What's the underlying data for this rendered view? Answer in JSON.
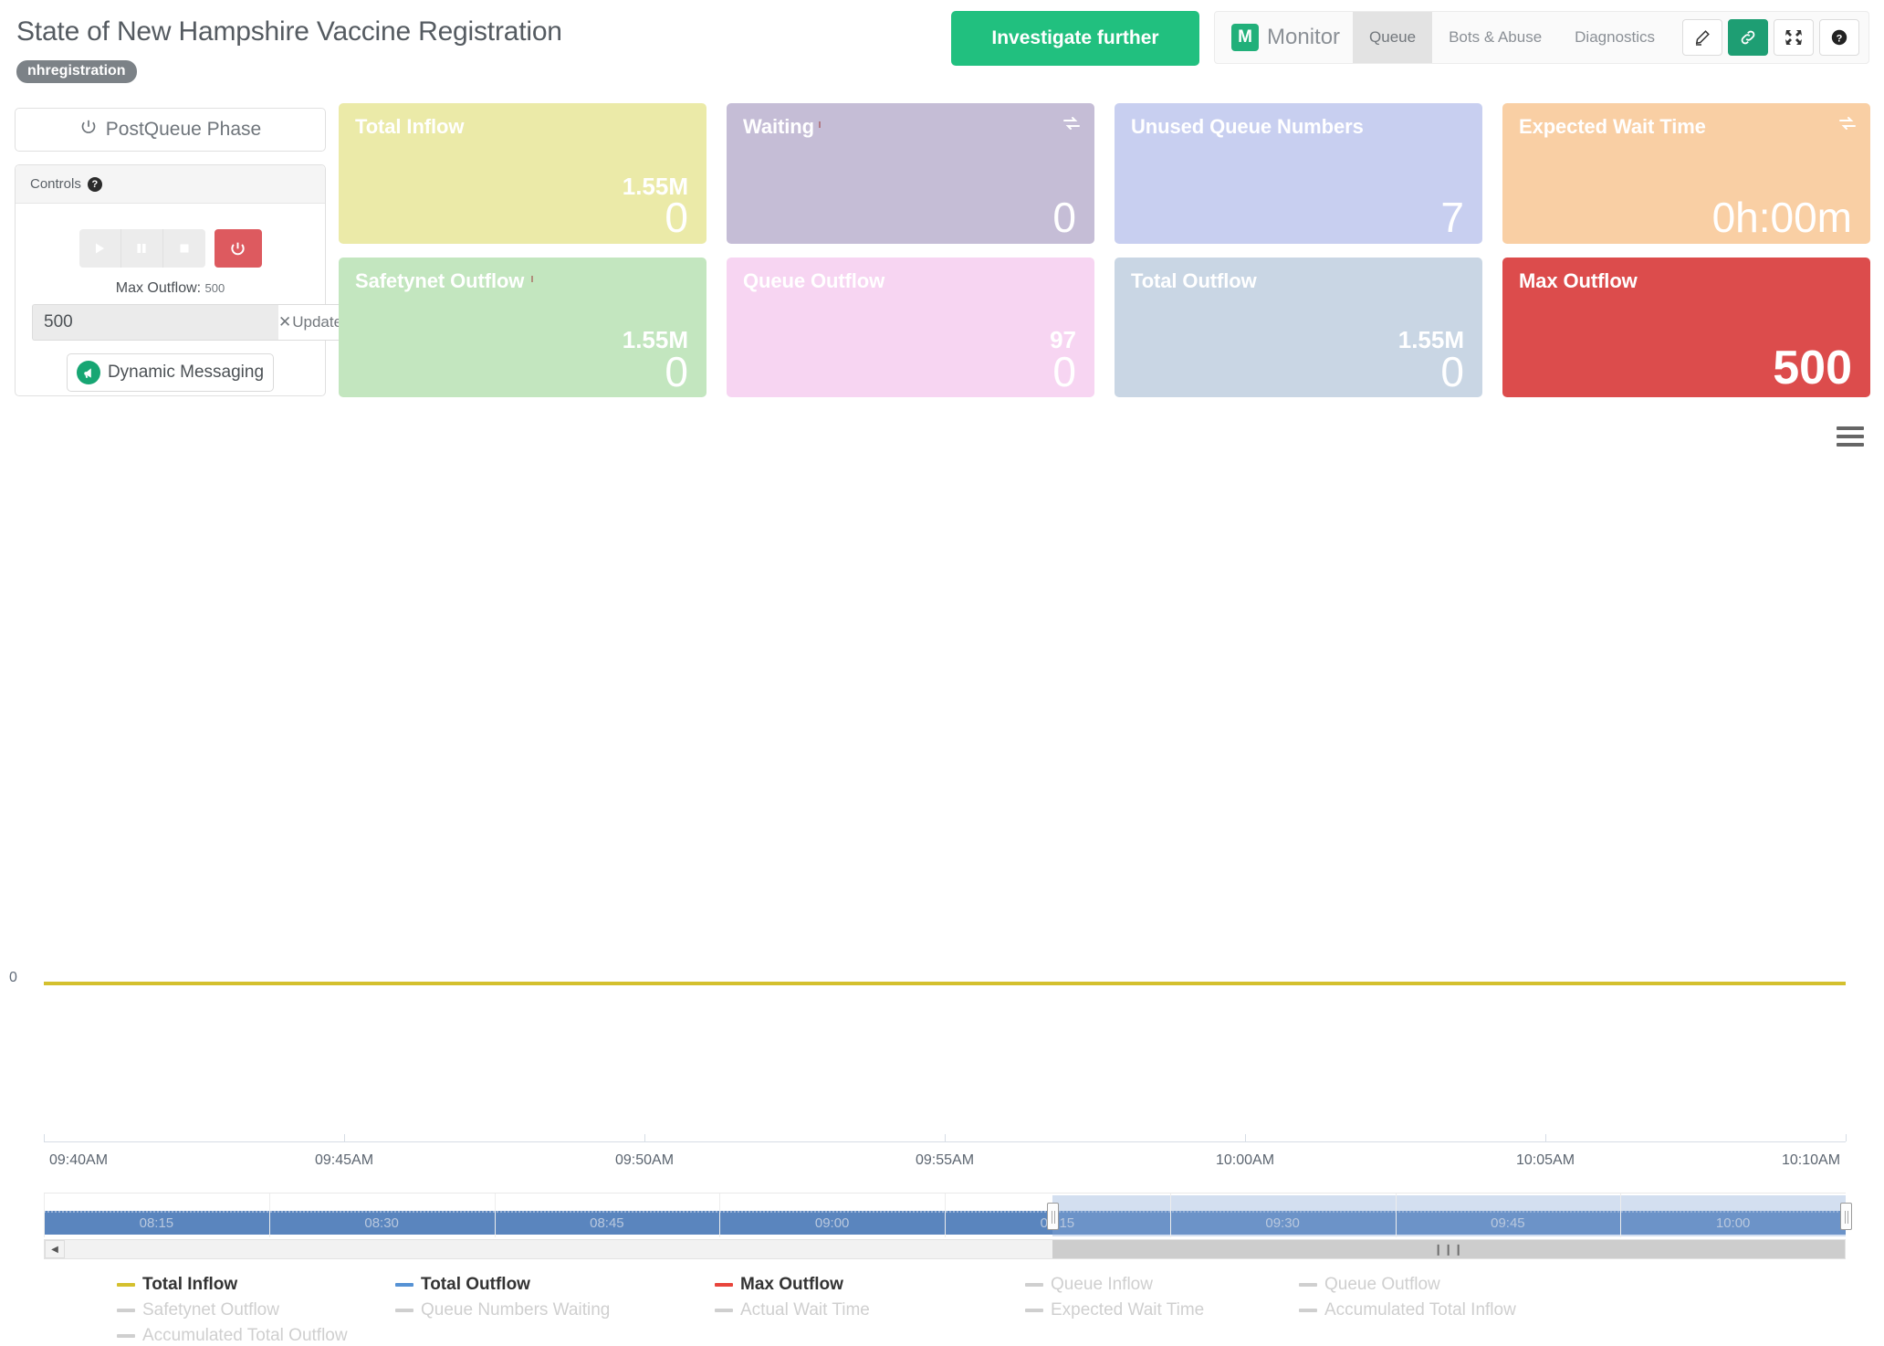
{
  "header": {
    "title": "State of New Hampshire Vaccine Registration",
    "badge": "nhregistration",
    "investigate_label": "Investigate further",
    "brand_mark": "M",
    "brand_name": "Monitor",
    "tabs": [
      {
        "label": "Queue",
        "active": true
      },
      {
        "label": "Bots & Abuse",
        "active": false
      },
      {
        "label": "Diagnostics",
        "active": false
      }
    ],
    "icons": [
      {
        "name": "edit-icon",
        "active": false
      },
      {
        "name": "link-icon",
        "active": true
      },
      {
        "name": "expand-icon",
        "active": false
      },
      {
        "name": "help-icon",
        "active": false
      }
    ]
  },
  "controls": {
    "phase_label": "PostQueue Phase",
    "panel_title": "Controls",
    "help_glyph": "?",
    "buttons": [
      {
        "name": "play-button",
        "label": "play"
      },
      {
        "name": "pause-button",
        "label": "pause"
      },
      {
        "name": "stop-button",
        "label": "stop"
      },
      {
        "name": "power-button",
        "label": "power"
      }
    ],
    "max_outflow_label": "Max Outflow:",
    "max_outflow_value": "500",
    "input_value": "500",
    "update_label": "Update",
    "update_prefix": "✕",
    "dynamic_messaging_label": "Dynamic Messaging"
  },
  "tiles": [
    {
      "title": "Total Inflow",
      "sub": "1.55M",
      "value": "0",
      "bg": "#ebeaa8",
      "refresh": false,
      "tick": false,
      "big": false
    },
    {
      "title": "Waiting",
      "sub": "",
      "value": "0",
      "bg": "#c5bdd6",
      "refresh": true,
      "tick": true,
      "big": false
    },
    {
      "title": "Unused Queue Numbers",
      "sub": "",
      "value": "7",
      "bg": "#c8cff0",
      "refresh": false,
      "tick": false,
      "big": false
    },
    {
      "title": "Expected Wait Time",
      "sub": "",
      "value": "0h:00m",
      "bg": "#f9cfa4",
      "refresh": true,
      "tick": false,
      "big": false
    },
    {
      "title": "Safetynet Outflow",
      "sub": "1.55M",
      "value": "0",
      "bg": "#c3e6bf",
      "refresh": false,
      "tick": true,
      "big": false
    },
    {
      "title": "Queue Outflow",
      "sub": "97",
      "value": "0",
      "bg": "#f7d5f2",
      "refresh": false,
      "tick": false,
      "big": false
    },
    {
      "title": "Total Outflow",
      "sub": "1.55M",
      "value": "0",
      "bg": "#c9d6e4",
      "refresh": false,
      "tick": false,
      "big": false
    },
    {
      "title": "Max Outflow",
      "sub": "",
      "value": "500",
      "bg": "#dc4c4c",
      "refresh": false,
      "tick": false,
      "big": true
    }
  ],
  "chart_data": {
    "type": "line",
    "title": "",
    "xlabel": "",
    "ylabel": "",
    "x": [
      "09:40AM",
      "09:45AM",
      "09:50AM",
      "09:55AM",
      "10:00AM",
      "10:05AM",
      "10:10AM"
    ],
    "ylim": [
      0,
      0
    ],
    "ytick_labels": [
      "0"
    ],
    "grid": false,
    "legend_position": "bottom",
    "series": [
      {
        "name": "Total Inflow",
        "color": "#d4c02e",
        "visible": true,
        "values": [
          0,
          0,
          0,
          0,
          0,
          0,
          0
        ]
      },
      {
        "name": "Total Outflow",
        "color": "#5692d4",
        "visible": true,
        "values": [
          0,
          0,
          0,
          0,
          0,
          0,
          0
        ]
      },
      {
        "name": "Max Outflow",
        "color": "#e8453c",
        "visible": true,
        "values": [
          0,
          0,
          0,
          0,
          0,
          0,
          0
        ]
      },
      {
        "name": "Queue Inflow",
        "color": "#cfcfcf",
        "visible": false,
        "values": []
      },
      {
        "name": "Queue Outflow",
        "color": "#cfcfcf",
        "visible": false,
        "values": []
      },
      {
        "name": "Safetynet Outflow",
        "color": "#cfcfcf",
        "visible": false,
        "values": []
      },
      {
        "name": "Queue Numbers Waiting",
        "color": "#cfcfcf",
        "visible": false,
        "values": []
      },
      {
        "name": "Actual Wait Time",
        "color": "#cfcfcf",
        "visible": false,
        "values": []
      },
      {
        "name": "Expected Wait Time",
        "color": "#cfcfcf",
        "visible": false,
        "values": []
      },
      {
        "name": "Accumulated Total Inflow",
        "color": "#cfcfcf",
        "visible": false,
        "values": []
      },
      {
        "name": "Accumulated Total Outflow",
        "color": "#cfcfcf",
        "visible": false,
        "values": []
      }
    ]
  },
  "navigator": {
    "labels": [
      "08:15",
      "08:30",
      "08:45",
      "09:00",
      "09:15",
      "09:30",
      "09:45",
      "10:00"
    ],
    "selection_start_pct": 56.0,
    "selection_end_pct": 100.0,
    "scroll_thumb_start_pct": 56.0,
    "scroll_thumb_end_pct": 100.0
  }
}
